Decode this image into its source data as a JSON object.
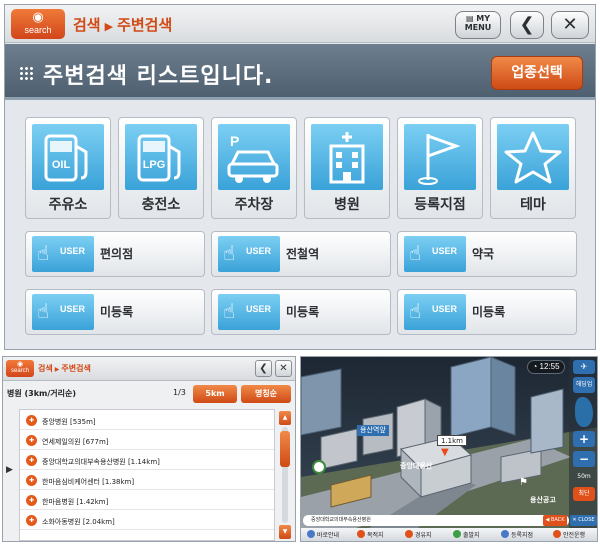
{
  "top": {
    "logo_text": "search",
    "breadcrumb": {
      "first": "검색",
      "second": "주변검색"
    },
    "my_menu": {
      "line1": "MY",
      "line2": "MENU"
    },
    "back_glyph": "❮",
    "close_glyph": "✕",
    "header_title": "주변검색 리스트입니다.",
    "category_button": "업종선택",
    "tiles": [
      {
        "label": "주유소",
        "icon": "oil-pump-icon",
        "icon_text": "OIL"
      },
      {
        "label": "충전소",
        "icon": "lpg-pump-icon",
        "icon_text": "LPG"
      },
      {
        "label": "주차장",
        "icon": "parking-car-icon",
        "icon_text": "P"
      },
      {
        "label": "병원",
        "icon": "hospital-icon",
        "icon_text": ""
      },
      {
        "label": "등록지점",
        "icon": "flag-icon",
        "icon_text": ""
      },
      {
        "label": "테마",
        "icon": "star-icon",
        "icon_text": ""
      }
    ],
    "user_badge": "USER",
    "user_buttons": [
      {
        "label": "편의점"
      },
      {
        "label": "전철역"
      },
      {
        "label": "약국"
      },
      {
        "label": "미등록"
      },
      {
        "label": "미등록"
      },
      {
        "label": "미등록"
      }
    ]
  },
  "list": {
    "breadcrumb": {
      "first": "검색",
      "second": "주변검색"
    },
    "search_label": "병원 (3km/거리순)",
    "page": "1/3",
    "distance_button": "5km",
    "sort_button": "명칭순",
    "items": [
      "중앙병원 [535m]",
      "연세제일의원 [677m]",
      "중앙대학교의대부속용산병원 [1.14km]",
      "한마음심비케어센터 [1.38km]",
      "한마음병원 [1.42km]",
      "소화아동병원 [2.04km]"
    ]
  },
  "map": {
    "time": "12:55",
    "labels": {
      "station": "용산역앞",
      "distance": "1.1km",
      "hospital": "중앙대용산",
      "park": "용산공고",
      "direction": "북",
      "heading_up": "헤딩업",
      "scale": "50m",
      "shortest": "최단"
    },
    "plus": "+",
    "minus": "−",
    "status_text": "중앙대학교의대부속용산병원",
    "back_btn": "◀ BACK",
    "close_btn": "✕ CLOSE",
    "menu": [
      {
        "label": "바로안내",
        "color": "#4a78c8"
      },
      {
        "label": "목적지",
        "color": "#e0501a"
      },
      {
        "label": "경유지",
        "color": "#e0501a"
      },
      {
        "label": "출발지",
        "color": "#3ea045"
      },
      {
        "label": "등록지점",
        "color": "#4a78c8"
      },
      {
        "label": "안전운행",
        "color": "#e0501a"
      }
    ]
  },
  "colors": {
    "accent": "#d24a16",
    "icon_blue": "#3aa2d8",
    "header": "#5a6b7c"
  }
}
